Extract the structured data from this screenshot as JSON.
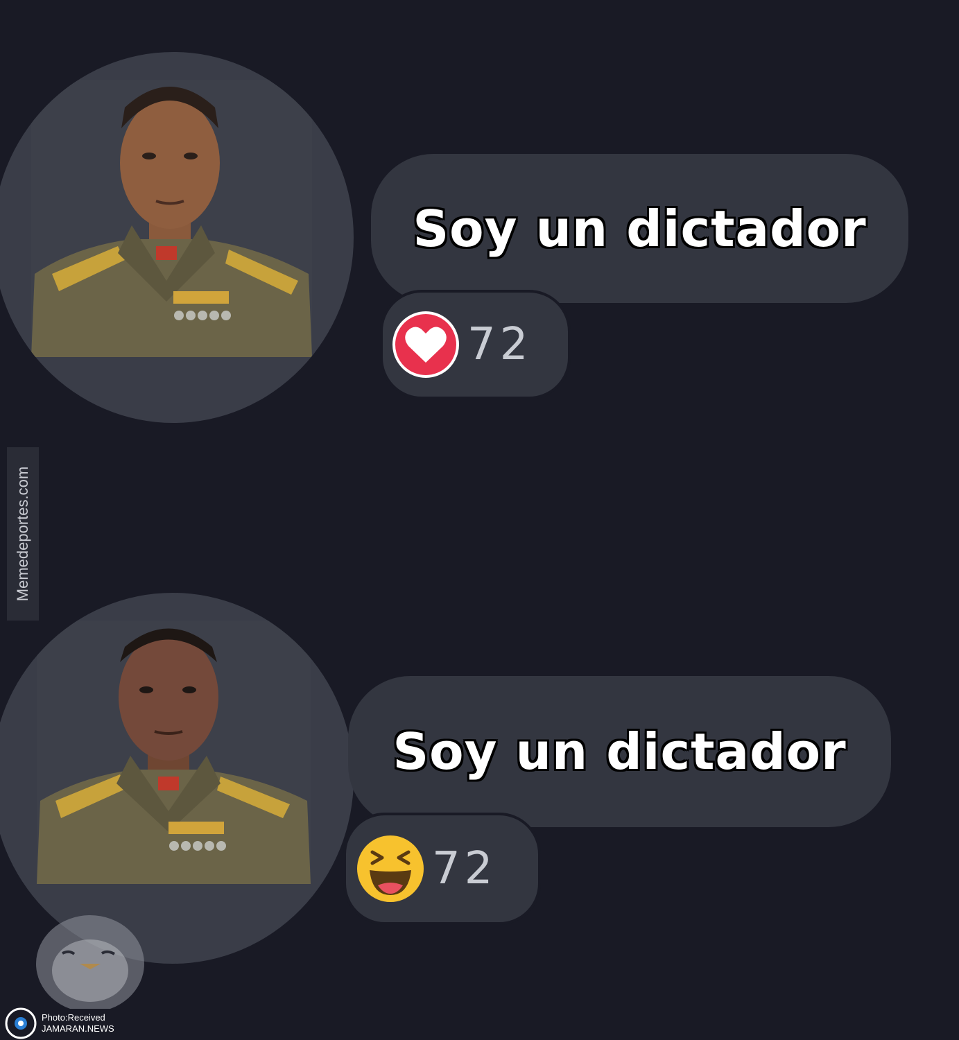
{
  "posts": [
    {
      "avatar_icon": "soldier-portrait-icon",
      "message": "Soy un dictador",
      "reaction": {
        "icon": "heart-reaction-icon",
        "color": "#e8314d",
        "count": "72"
      }
    },
    {
      "avatar_icon": "soldier-portrait-icon",
      "message": "Soy un dictador",
      "reaction": {
        "icon": "laughing-reaction-icon",
        "color": "#f7c22e",
        "count": "72"
      }
    }
  ],
  "watermark": {
    "side_text": "Memedeportes.com"
  },
  "footer": {
    "line1": "Photo:Received",
    "line2": "JAMARAN.NEWS"
  },
  "colors": {
    "background": "#191a25",
    "bubble": "#333640",
    "avatar_bg": "#3a3d48"
  }
}
